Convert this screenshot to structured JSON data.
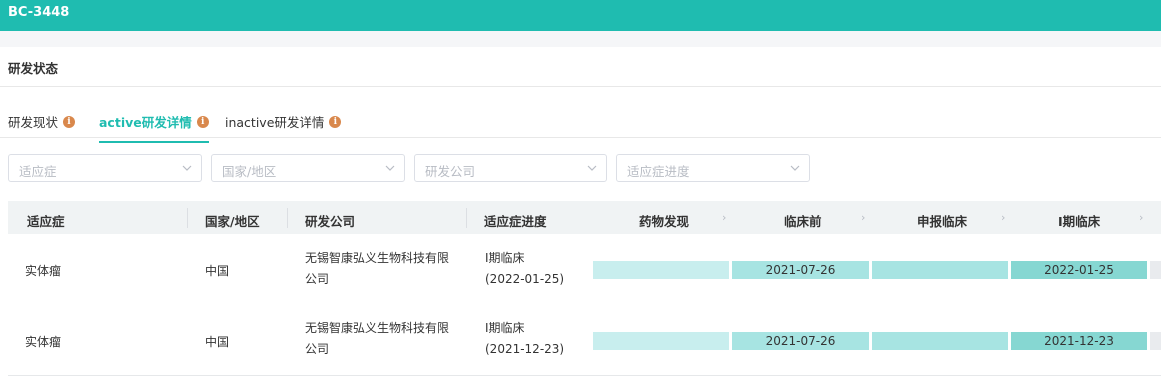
{
  "header": {
    "title": "BC-3448"
  },
  "section": {
    "title": "研发状态"
  },
  "tabs": [
    {
      "label": "研发现状"
    },
    {
      "label": "active研发详情"
    },
    {
      "label": "inactive研发详情"
    }
  ],
  "filters": [
    {
      "placeholder": "适应症"
    },
    {
      "placeholder": "国家/地区"
    },
    {
      "placeholder": "研发公司"
    },
    {
      "placeholder": "适应症进度"
    }
  ],
  "table": {
    "headers": [
      "适应症",
      "国家/地区",
      "研发公司",
      "适应症进度"
    ],
    "stages": [
      "药物发现",
      "临床前",
      "申报临床",
      "Ⅰ期临床"
    ],
    "rows": [
      {
        "indication": "实体瘤",
        "country": "中国",
        "company_line1": "无锡智康弘义生物科技有限",
        "company_line2": "公司",
        "progress_line1": "Ⅰ期临床",
        "progress_line2": "(2022-01-25)",
        "stage_dates": [
          "",
          "2021-07-26",
          "",
          "2022-01-25"
        ]
      },
      {
        "indication": "实体瘤",
        "country": "中国",
        "company_line1": "无锡智康弘义生物科技有限",
        "company_line2": "公司",
        "progress_line1": "Ⅰ期临床",
        "progress_line2": "(2021-12-23)",
        "stage_dates": [
          "",
          "2021-07-26",
          "",
          "2021-12-23"
        ]
      }
    ]
  },
  "colors": {
    "accent": "#1fbcb0",
    "info": "#d9884c"
  }
}
